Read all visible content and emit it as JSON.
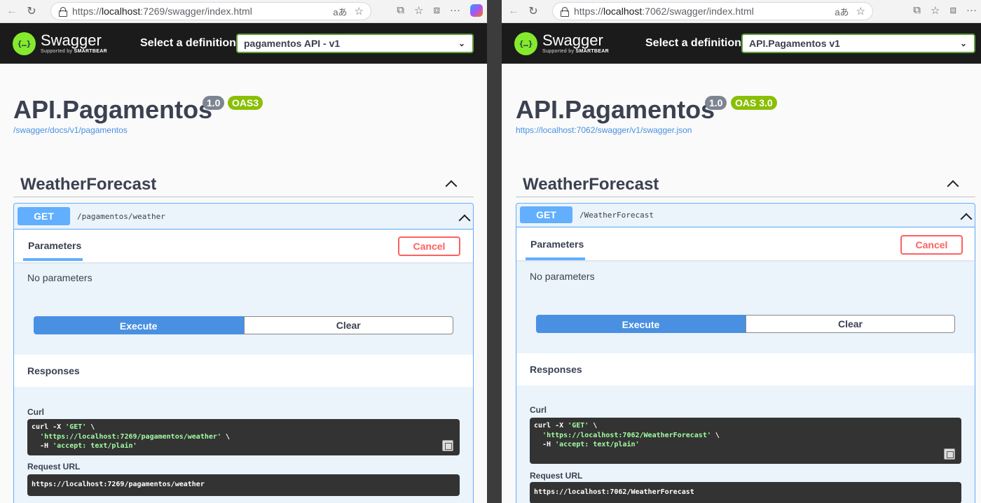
{
  "left": {
    "url_prefix": "https://",
    "url_host": "localhost",
    "url_rest": ":7269/swagger/index.html",
    "swagger_brand": "Swagger",
    "supported_by": "Supported by",
    "smartbear": "SMARTBEAR",
    "select_label": "Select a definition",
    "selected_definition": "pagamentos API - v1",
    "title": "API.Pagamentos",
    "version_badge": "1.0",
    "oas_badge": "OAS3",
    "spec_link": "/swagger/docs/v1/pagamentos",
    "tag": "WeatherForecast",
    "method": "GET",
    "path": "/pagamentos/weather",
    "parameters_tab": "Parameters",
    "cancel": "Cancel",
    "no_params": "No parameters",
    "execute": "Execute",
    "clear": "Clear",
    "responses": "Responses",
    "curl_label": "Curl",
    "curl_line1": "curl -X ",
    "curl_get": "'GET'",
    "curl_bs": " \\",
    "curl_url": "'https://localhost:7269/pagamentos/weather'",
    "curl_header": "'accept: text/plain'",
    "request_url_label": "Request URL",
    "request_url": "https://localhost:7269/pagamentos/weather"
  },
  "right": {
    "url_prefix": "https://",
    "url_host": "localhost",
    "url_rest": ":7062/swagger/index.html",
    "swagger_brand": "Swagger",
    "supported_by": "Supported by",
    "smartbear": "SMARTBEAR",
    "select_label": "Select a definition",
    "selected_definition": "API.Pagamentos v1",
    "title": "API.Pagamentos",
    "version_badge": "1.0",
    "oas_badge": "OAS 3.0",
    "spec_link": "https://localhost:7062/swagger/v1/swagger.json",
    "tag": "WeatherForecast",
    "method": "GET",
    "path": "/WeatherForecast",
    "parameters_tab": "Parameters",
    "cancel": "Cancel",
    "no_params": "No parameters",
    "execute": "Execute",
    "clear": "Clear",
    "responses": "Responses",
    "curl_label": "Curl",
    "curl_line1": "curl -X ",
    "curl_get": "'GET'",
    "curl_bs": " \\",
    "curl_url": "'https://localhost:7062/WeatherForecast'",
    "curl_header": "'accept: text/plain'",
    "request_url_label": "Request URL",
    "request_url": "https://localhost:7062/WeatherForecast"
  },
  "browser": {
    "back_icon": "←",
    "refresh_icon": "↻",
    "read_aloud_icon": "aあ",
    "favorite_icon": "☆",
    "menu_icon": "···"
  },
  "colors": {
    "get_blue": "#61affe",
    "execute_blue": "#4990e2",
    "swagger_green": "#85ea2d",
    "oas_green": "#89bf04",
    "cancel_red": "#ff6060"
  }
}
